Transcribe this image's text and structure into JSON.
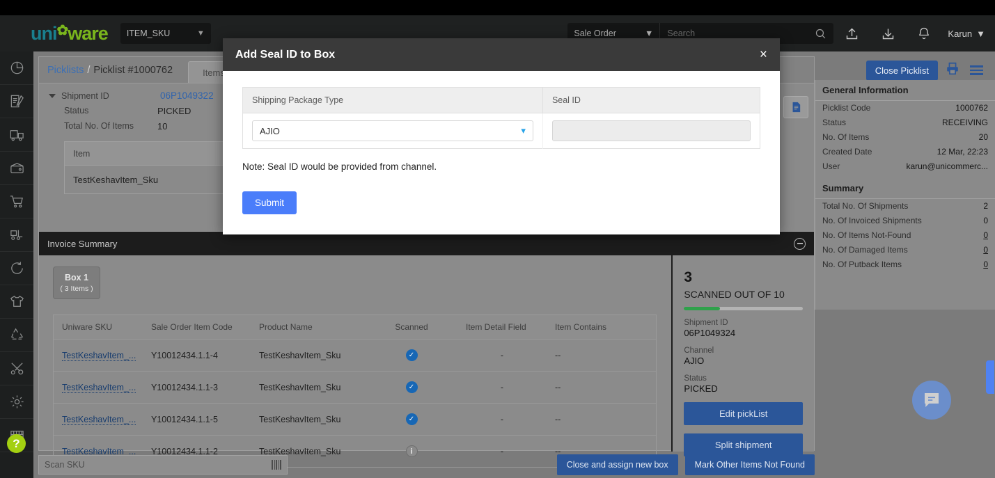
{
  "header": {
    "logo_uni": "uni",
    "logo_ware": "ware",
    "module_select": "ITEM_SKU",
    "search_scope": "Sale Order",
    "search_placeholder": "Search",
    "user": "Karun"
  },
  "rail": {
    "items": [
      {
        "icon": "pie-chart-icon"
      },
      {
        "icon": "document-edit-icon"
      },
      {
        "icon": "truck-icon"
      },
      {
        "icon": "wallet-icon"
      },
      {
        "icon": "shopping-cart-icon"
      },
      {
        "icon": "forklift-icon"
      },
      {
        "icon": "refresh-return-icon"
      },
      {
        "icon": "tshirt-icon"
      },
      {
        "icon": "recycle-icon"
      },
      {
        "icon": "tools-icon"
      },
      {
        "icon": "gear-icon"
      },
      {
        "icon": "warehouse-icon"
      }
    ],
    "help_label": "?"
  },
  "breadcrumb": {
    "root": "Picklists",
    "separator": "/",
    "current": "Picklist #1000762",
    "tab": "Items"
  },
  "shipment": {
    "label": "Shipment ID",
    "id": "06P1049322",
    "rows": [
      {
        "label": "Status",
        "value": "PICKED"
      },
      {
        "label": "Total No. Of Items",
        "value": "10"
      }
    ],
    "mini_table": {
      "header": "Item",
      "rows": [
        "TestKeshavItem_Sku"
      ]
    }
  },
  "actions": {
    "close_picklist": "Close Picklist",
    "print_icon": "printer-icon",
    "menu_icon": "hamburger-icon",
    "doc_icon": "document-icon"
  },
  "general_information": {
    "title": "General Information",
    "rows": [
      {
        "label": "Picklist Code",
        "value": "1000762"
      },
      {
        "label": "Status",
        "value": "RECEIVING"
      },
      {
        "label": "No. Of Items",
        "value": "20"
      },
      {
        "label": "Created Date",
        "value": "12 Mar, 22:23"
      },
      {
        "label": "User",
        "value": "karun@unicommerc..."
      }
    ]
  },
  "summary": {
    "title": "Summary",
    "rows": [
      {
        "label": "Total No. Of Shipments",
        "value": "2",
        "underline": false
      },
      {
        "label": "No. Of Invoiced Shipments",
        "value": "0",
        "underline": false
      },
      {
        "label": "No. Of Items Not-Found",
        "value": "0",
        "underline": true
      },
      {
        "label": "No. Of Damaged Items",
        "value": "0",
        "underline": true
      },
      {
        "label": "No. Of Putback Items",
        "value": "0",
        "underline": true
      }
    ]
  },
  "invoice_summary": {
    "title": "Invoice Summary",
    "collapse_icon": "minus-circle-icon",
    "box": {
      "name": "Box 1",
      "count": "( 3 Items )"
    },
    "columns": [
      "Uniware SKU",
      "Sale Order Item Code",
      "Product Name",
      "Scanned",
      "Item Detail Field",
      "Item Contains"
    ],
    "rows": [
      {
        "sku": "TestKeshavItem_...",
        "code": "Y10012434.1.1-4",
        "product": "TestKeshavItem_Sku",
        "scanned": "check",
        "detail": "-",
        "contains": "--"
      },
      {
        "sku": "TestKeshavItem_...",
        "code": "Y10012434.1.1-3",
        "product": "TestKeshavItem_Sku",
        "scanned": "check",
        "detail": "-",
        "contains": "--"
      },
      {
        "sku": "TestKeshavItem_...",
        "code": "Y10012434.1.1-5",
        "product": "TestKeshavItem_Sku",
        "scanned": "check",
        "detail": "-",
        "contains": "--"
      },
      {
        "sku": "TestKeshavItem_...",
        "code": "Y10012434.1.1-2",
        "product": "TestKeshavItem_Sku",
        "scanned": "info",
        "detail": "-",
        "contains": "--"
      }
    ]
  },
  "scan_panel": {
    "count": "3",
    "scanned_label": "SCANNED OUT OF 10",
    "progress_percent": 30,
    "shipment_id_label": "Shipment ID",
    "shipment_id": "06P1049324",
    "channel_label": "Channel",
    "channel": "AJIO",
    "status_label": "Status",
    "status": "PICKED",
    "edit_button": "Edit pickList",
    "split_button": "Split shipment"
  },
  "bottom_bar": {
    "scan_placeholder": "Scan SKU",
    "scan_value": "",
    "barcode_icon": "barcode-icon",
    "close_box_button": "Close and assign new box",
    "not_found_button": "Mark Other Items Not Found"
  },
  "floating": {
    "chat_icon": "chat-bubble-icon",
    "side_tab": "side-tab-handle"
  },
  "modal": {
    "title": "Add Seal ID to Box",
    "close": "×",
    "col_package_type": "Shipping Package Type",
    "col_seal_id": "Seal ID",
    "package_type_value": "AJIO",
    "seal_id_value": "",
    "seal_id_placeholder": "",
    "note": "Note: Seal ID would be provided from channel.",
    "submit": "Submit"
  },
  "colors": {
    "accent_blue": "#2b5699",
    "submit_blue": "#4a7dfa",
    "progress_green": "#2fa14b",
    "link_blue": "#3b6fb5",
    "logo_teal": "#1a7f8e",
    "logo_green": "#7ab51d"
  }
}
